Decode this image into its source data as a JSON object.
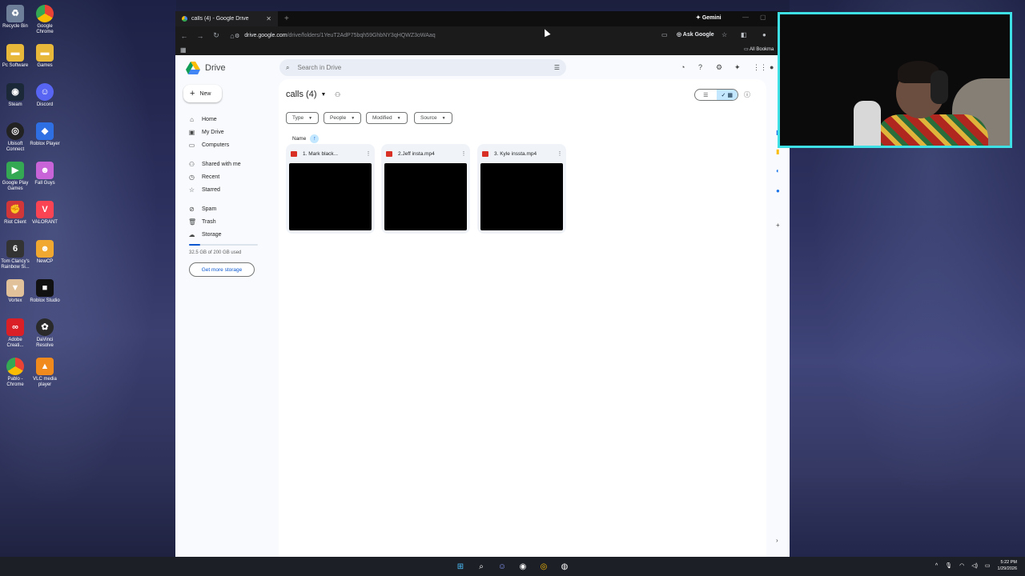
{
  "desktop": {
    "icons_col1": [
      "Recycle Bin",
      "Pc Software",
      "Steam",
      "Ubisoft Connect",
      "Google Play Games",
      "Riot Client",
      "Tom Clancy's Rainbow Si...",
      "Vortex",
      "Adobe Creati...",
      "Pablo - Chrome"
    ],
    "icons_col2": [
      "Google Chrome",
      "Games",
      "Discord",
      "Roblox Player",
      "Fall Guys",
      "VALORANT",
      "NewCP",
      "Roblox Studio",
      "DaVinci Resolve",
      "VLC media player"
    ]
  },
  "browser": {
    "tab_title": "calls (4) - Google Drive",
    "gemini_label": "Gemini",
    "url_host": "drive.google.com",
    "url_path": "/drive/folders/1YeuT2AdP75bqh59GhbNY3qHQWZ3oWAaq",
    "ask_google_label": "Ask Google",
    "all_bookmarks_label": "All Bookma"
  },
  "drive": {
    "logo_text": "Drive",
    "search_placeholder": "Search in Drive",
    "new_label": "New",
    "nav": {
      "home": "Home",
      "my_drive": "My Drive",
      "computers": "Computers",
      "shared": "Shared with me",
      "recent": "Recent",
      "starred": "Starred",
      "spam": "Spam",
      "trash": "Trash",
      "storage": "Storage"
    },
    "storage_used_text": "32.5 GB of 200 GB used",
    "storage_fraction": 0.1625,
    "get_more_storage": "Get more storage",
    "folder_title": "calls (4)",
    "filters": [
      "Type",
      "People",
      "Modified",
      "Source"
    ],
    "sort_label": "Name",
    "files": [
      {
        "name": "1. Mark black..."
      },
      {
        "name": "2.Jeff insta.mp4"
      },
      {
        "name": "3. Kyle inssta.mp4"
      }
    ]
  },
  "taskbar": {
    "time": "5:22 PM",
    "date": "1/29/2026"
  },
  "colors": {
    "webcam_border": "#3ee0e6",
    "drive_accent": "#0b57d0",
    "video_icon": "#d93025"
  }
}
